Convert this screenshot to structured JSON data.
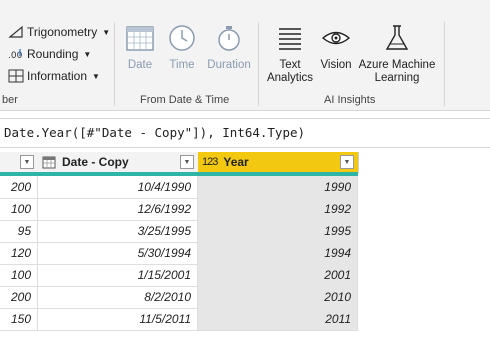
{
  "ribbon": {
    "number_group": {
      "items": [
        {
          "label": "Trigonometry",
          "icon": "triangle-icon"
        },
        {
          "label": "Rounding",
          "icon": "rounding-icon"
        },
        {
          "label": "Information",
          "icon": "information-icon"
        }
      ],
      "group_label": "ber"
    },
    "date_time_group": {
      "buttons": [
        {
          "label": "Date",
          "icon": "calendar-icon"
        },
        {
          "label": "Time",
          "icon": "clock-icon"
        },
        {
          "label": "Duration",
          "icon": "stopwatch-icon"
        }
      ],
      "group_label": "From Date & Time"
    },
    "ai_group": {
      "buttons": [
        {
          "label_line1": "Text",
          "label_line2": "Analytics",
          "icon": "text-lines-icon"
        },
        {
          "label_line1": "Vision",
          "label_line2": "",
          "icon": "eye-icon"
        },
        {
          "label_line1": "Azure Machine",
          "label_line2": "Learning",
          "icon": "flask-icon"
        }
      ],
      "group_label": "AI Insights"
    }
  },
  "formula_bar": {
    "text": "Date.Year([#\"Date - Copy\"]), Int64.Type)"
  },
  "table": {
    "columns": [
      {
        "label": "",
        "type_icon": ""
      },
      {
        "label": "Date - Copy",
        "type_icon": "calendar-type-icon"
      },
      {
        "label": "Year",
        "type_icon": "123"
      }
    ],
    "rows": [
      [
        "200",
        "10/4/1990",
        "1990"
      ],
      [
        "100",
        "12/6/1992",
        "1992"
      ],
      [
        "95",
        "3/25/1995",
        "1995"
      ],
      [
        "120",
        "5/30/1994",
        "1994"
      ],
      [
        "100",
        "1/15/2001",
        "2001"
      ],
      [
        "200",
        "8/2/2010",
        "2010"
      ],
      [
        "150",
        "11/5/2011",
        "2011"
      ]
    ]
  },
  "colors": {
    "selected_header": "#f2c811",
    "quality_bar": "#2fb5a5",
    "disabled_icon": "#8a9bb0"
  }
}
